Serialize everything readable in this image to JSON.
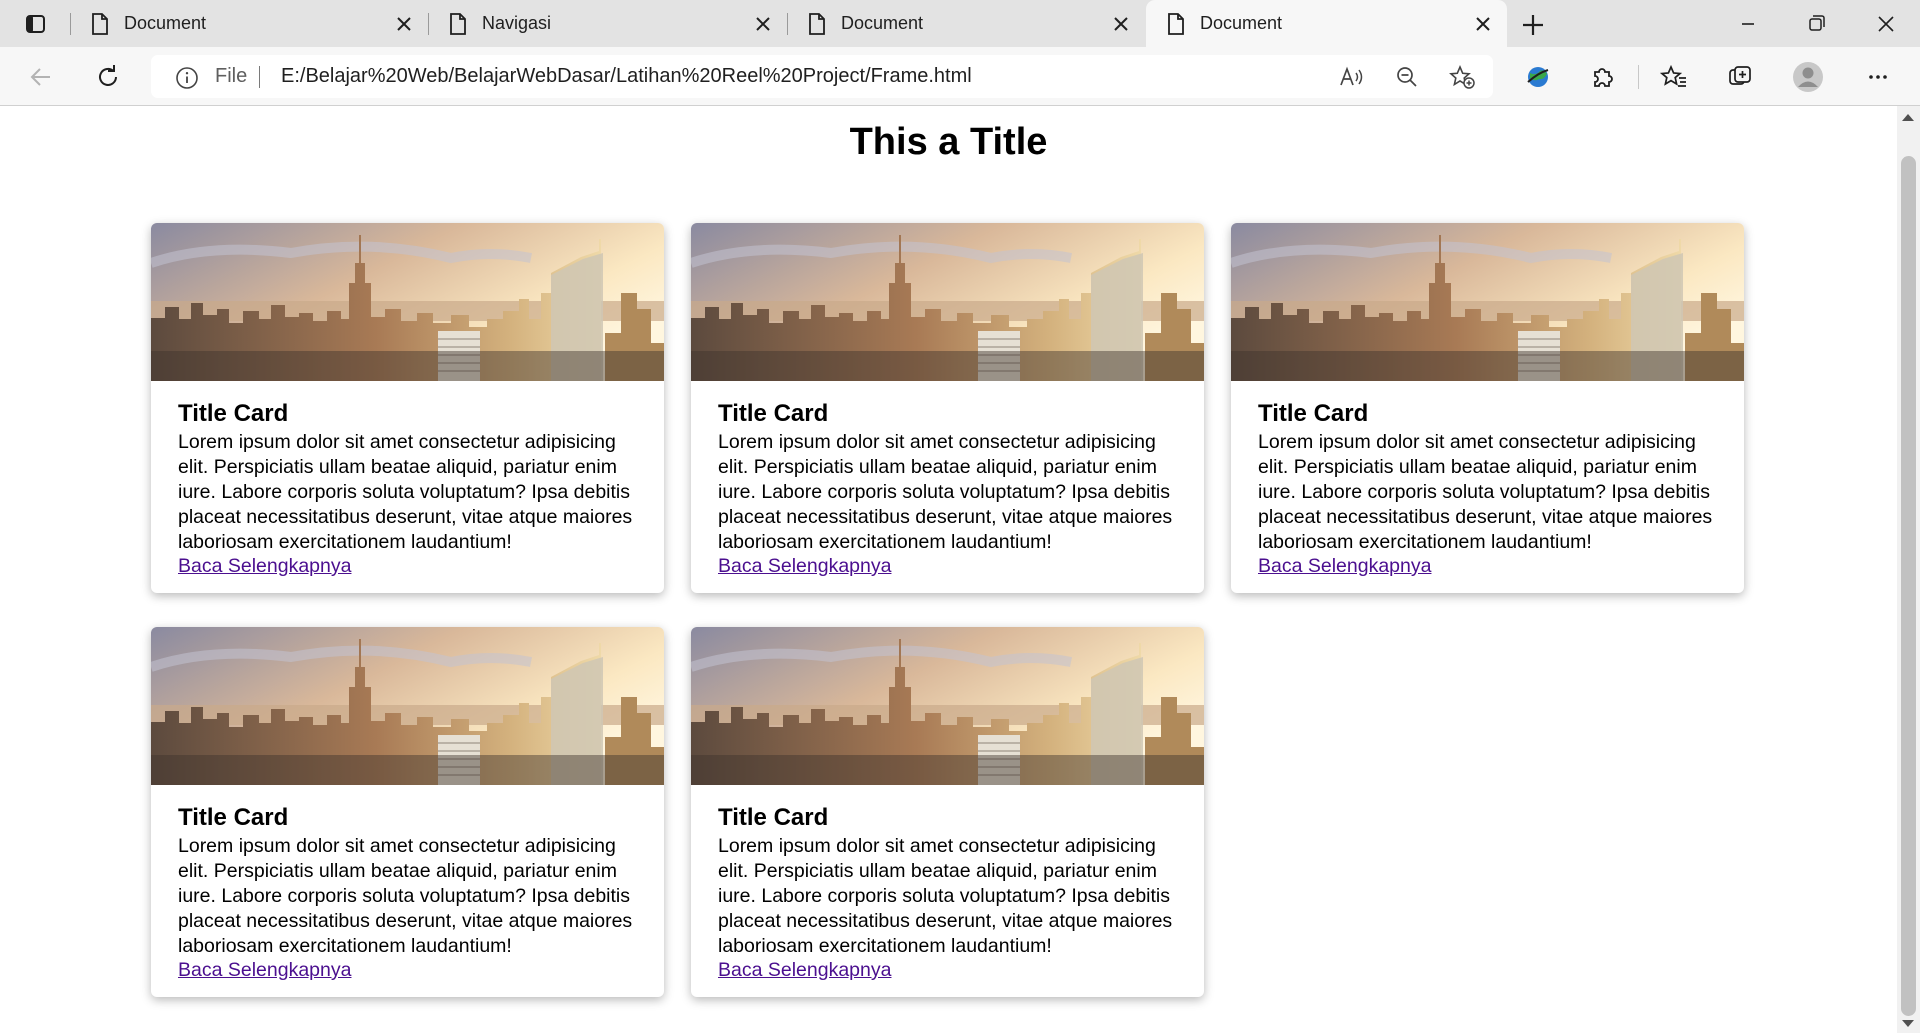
{
  "browser": {
    "tabs": [
      {
        "title": "Document",
        "active": false,
        "favicon": "page-icon"
      },
      {
        "title": "Navigasi",
        "active": false,
        "favicon": "page-icon"
      },
      {
        "title": "Document",
        "active": false,
        "favicon": "page-icon"
      },
      {
        "title": "Document",
        "active": true,
        "favicon": "page-icon"
      }
    ],
    "address": {
      "scheme": "File",
      "url": "E:/Belajar%20Web/BelajarWebDasar/Latihan%20Reel%20Project/Frame.html"
    },
    "icons": {
      "tab_actions": "tab-actions-icon",
      "new_tab": "plus-icon",
      "back": "back-arrow-icon",
      "refresh": "refresh-icon",
      "site_info": "info-icon",
      "read_aloud": "read-aloud-icon",
      "zoom_out": "zoom-out-icon",
      "add_favorite": "add-favorite-icon",
      "extension_globe": "globe-extension-icon",
      "extensions": "puzzle-icon",
      "favorites": "favorites-icon",
      "collections": "collections-icon",
      "profile": "avatar-icon",
      "more": "more-icon"
    }
  },
  "page": {
    "title": "This a Title",
    "cards": [
      {
        "title": "Title Card",
        "text": "Lorem ipsum dolor sit amet consectetur adipisicing elit. Perspiciatis ullam beatae aliquid, pariatur enim iure. Labore corporis soluta voluptatum? Ipsa debitis placeat necessitatibus deserunt, vitae atque maiores laboriosam exercitationem laudantium!",
        "link": "Baca Selengkapnya"
      },
      {
        "title": "Title Card",
        "text": "Lorem ipsum dolor sit amet consectetur adipisicing elit. Perspiciatis ullam beatae aliquid, pariatur enim iure. Labore corporis soluta voluptatum? Ipsa debitis placeat necessitatibus deserunt, vitae atque maiores laboriosam exercitationem laudantium!",
        "link": "Baca Selengkapnya"
      },
      {
        "title": "Title Card",
        "text": "Lorem ipsum dolor sit amet consectetur adipisicing elit. Perspiciatis ullam beatae aliquid, pariatur enim iure. Labore corporis soluta voluptatum? Ipsa debitis placeat necessitatibus deserunt, vitae atque maiores laboriosam exercitationem laudantium!",
        "link": "Baca Selengkapnya"
      },
      {
        "title": "Title Card",
        "text": "Lorem ipsum dolor sit amet consectetur adipisicing elit. Perspiciatis ullam beatae aliquid, pariatur enim iure. Labore corporis soluta voluptatum? Ipsa debitis placeat necessitatibus deserunt, vitae atque maiores laboriosam exercitationem laudantium!",
        "link": "Baca Selengkapnya"
      },
      {
        "title": "Title Card",
        "text": "Lorem ipsum dolor sit amet consectetur adipisicing elit. Perspiciatis ullam beatae aliquid, pariatur enim iure. Labore corporis soluta voluptatum? Ipsa debitis placeat necessitatibus deserunt, vitae atque maiores laboriosam exercitationem laudantium!",
        "link": "Baca Selengkapnya"
      }
    ],
    "colors": {
      "link": "#4b0f8f",
      "tabstrip": "#e3e3e3",
      "toolbar": "#f7f7f7"
    }
  }
}
